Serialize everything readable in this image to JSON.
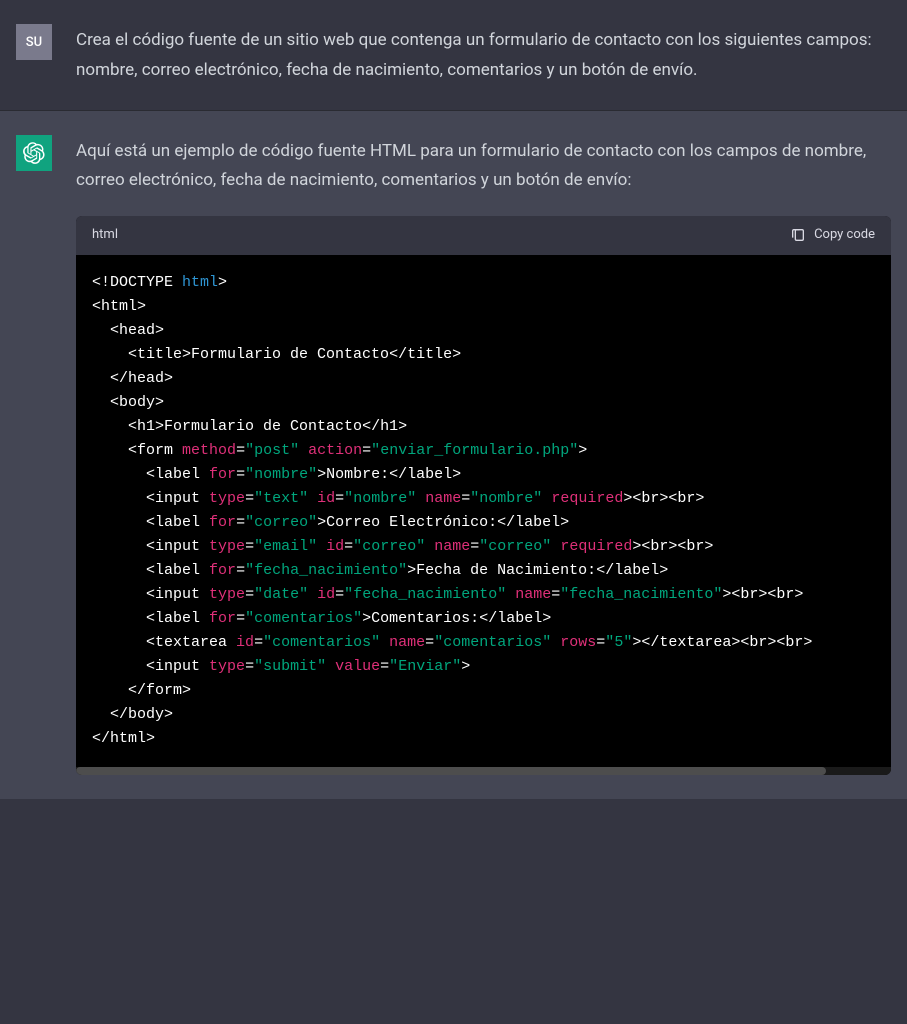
{
  "user": {
    "avatar_initials": "SU",
    "message": "Crea el código fuente de un sitio web que contenga un formulario de contacto con los siguientes campos: nombre, correo electrónico, fecha de nacimiento, comentarios y un botón de envío."
  },
  "assistant": {
    "intro": "Aquí está un ejemplo de código fuente HTML para un formulario de contacto con los campos de nombre, correo electrónico, fecha de nacimiento, comentarios y un botón de envío:",
    "code_lang": "html",
    "copy_label": "Copy code",
    "code": {
      "doctype": "<!DOCTYPE",
      "doctype_kw": "html",
      "title_text": "Formulario de Contacto",
      "h1_text": "Formulario de Contacto",
      "form_method": "post",
      "form_action": "enviar_formulario.php",
      "label_nombre_for": "nombre",
      "label_nombre_text": "Nombre:",
      "input_nombre_type": "text",
      "input_nombre_id": "nombre",
      "input_nombre_name": "nombre",
      "label_correo_for": "correo",
      "label_correo_text": "Correo Electrónico:",
      "input_correo_type": "email",
      "input_correo_id": "correo",
      "input_correo_name": "correo",
      "label_fecha_for": "fecha_nacimiento",
      "label_fecha_text": "Fecha de Nacimiento:",
      "input_fecha_type": "date",
      "input_fecha_id": "fecha_nacimiento",
      "input_fecha_name": "fecha_nacimiento",
      "label_coment_for": "comentarios",
      "label_coment_text": "Comentarios:",
      "textarea_id": "comentarios",
      "textarea_name": "comentarios",
      "textarea_rows": "5",
      "input_submit_type": "submit",
      "input_submit_value": "Enviar"
    }
  }
}
